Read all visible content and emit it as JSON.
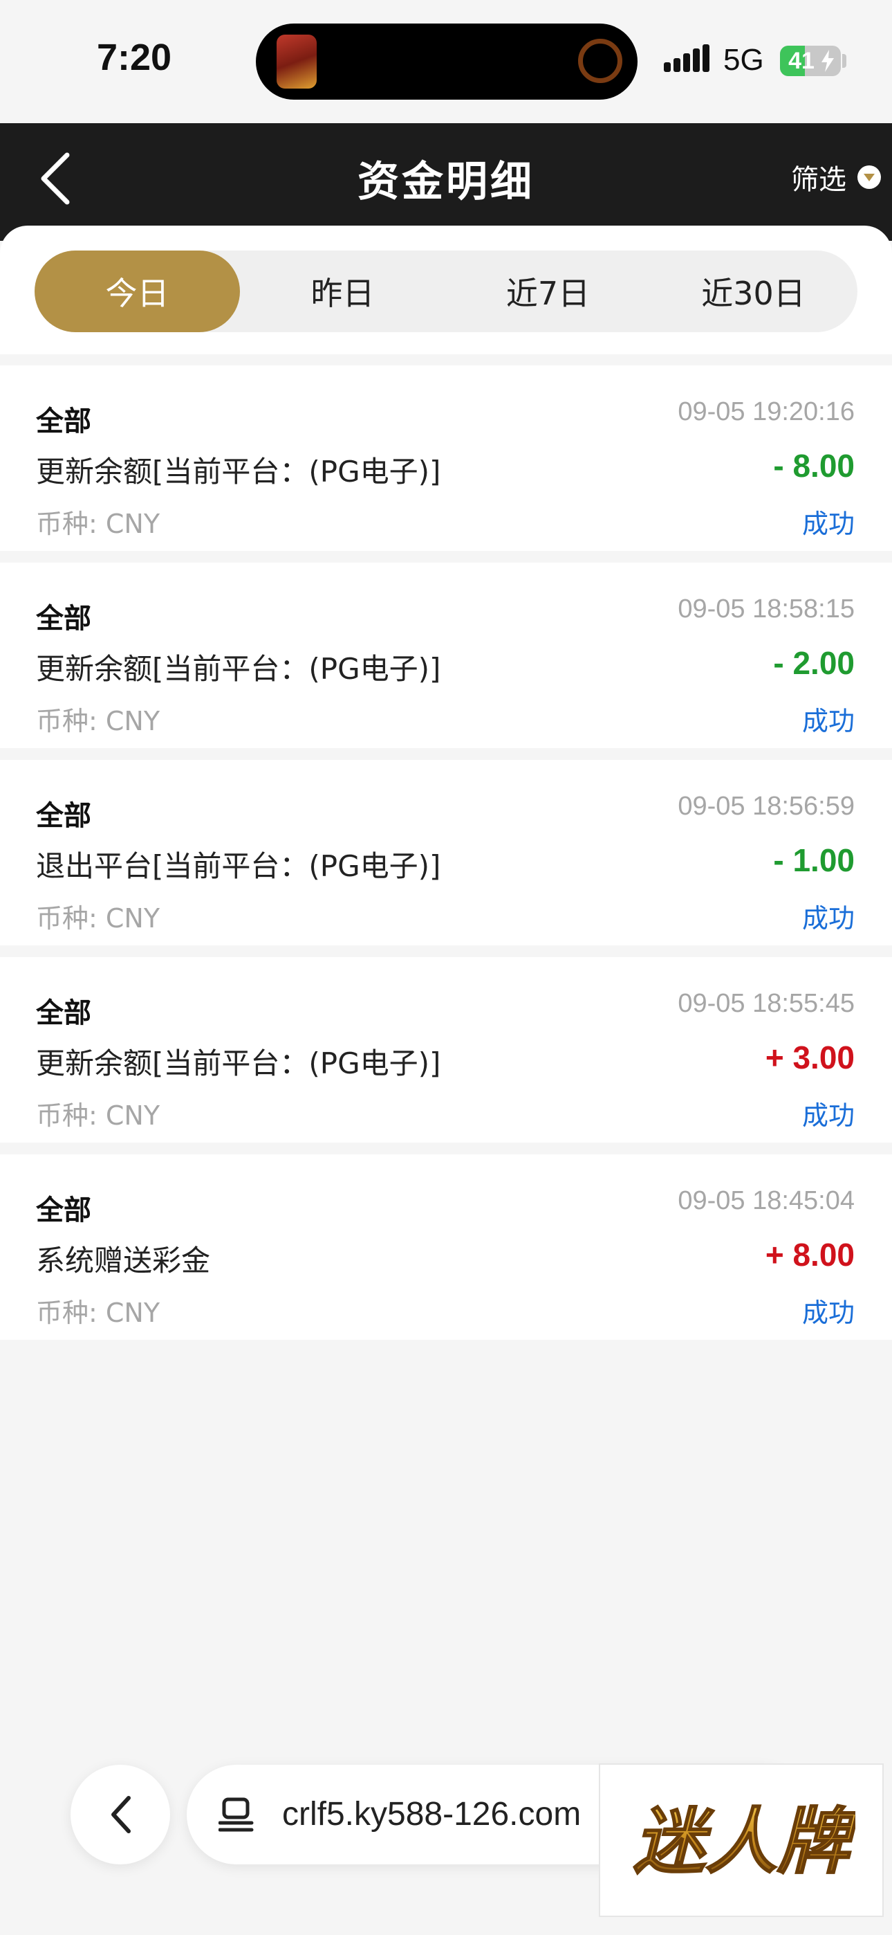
{
  "status_bar": {
    "time": "7:20",
    "network": "5G",
    "battery_percent": 41,
    "battery_label": "41"
  },
  "header": {
    "title": "资金明细",
    "filter_label": "筛选"
  },
  "tabs": [
    {
      "label": "今日",
      "active": true
    },
    {
      "label": "昨日",
      "active": false
    },
    {
      "label": "近7日",
      "active": false
    },
    {
      "label": "近30日",
      "active": false
    }
  ],
  "transactions": [
    {
      "type": "全部",
      "time": "09-05 19:20:16",
      "description": "更新余额[当前平台：(PG电子)]",
      "amount": "- 8.00",
      "amount_color": "#1f9b30",
      "currency": "币种: CNY",
      "status": "成功"
    },
    {
      "type": "全部",
      "time": "09-05 18:58:15",
      "description": "更新余额[当前平台：(PG电子)]",
      "amount": "- 2.00",
      "amount_color": "#1f9b30",
      "currency": "币种: CNY",
      "status": "成功"
    },
    {
      "type": "全部",
      "time": "09-05 18:56:59",
      "description": "退出平台[当前平台：(PG电子)]",
      "amount": "- 1.00",
      "amount_color": "#1f9b30",
      "currency": "币种: CNY",
      "status": "成功"
    },
    {
      "type": "全部",
      "time": "09-05 18:55:45",
      "description": "更新余额[当前平台：(PG电子)]",
      "amount": "+ 3.00",
      "amount_color": "#d0121c",
      "currency": "币种: CNY",
      "status": "成功"
    },
    {
      "type": "全部",
      "time": "09-05 18:45:04",
      "description": "系统赠送彩金",
      "amount": "+ 8.00",
      "amount_color": "#d0121c",
      "currency": "币种: CNY",
      "status": "成功"
    }
  ],
  "browser": {
    "url": "crlf5.ky588-126.com"
  },
  "watermark": {
    "text": "迷人牌"
  },
  "colors": {
    "accent": "#b39146",
    "header_bg": "#1c1c1c",
    "status_link": "#1a6ed8"
  }
}
